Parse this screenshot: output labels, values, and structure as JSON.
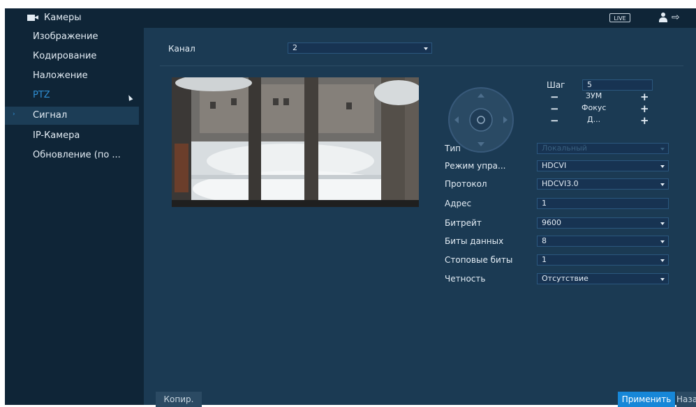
{
  "header": {
    "brand": "Камеры",
    "live_badge": "LIVE",
    "user_icon": "user-icon",
    "logout_icon": "logout-icon"
  },
  "sidebar": {
    "items": [
      {
        "label": "Изображение"
      },
      {
        "label": "Кодирование"
      },
      {
        "label": "Наложение"
      },
      {
        "label": "PTZ",
        "active": true
      },
      {
        "label": "Сигнал"
      },
      {
        "label": "IP-Камера"
      },
      {
        "label": "Обновление (по ..."
      }
    ],
    "active_color": "#2f8fd4"
  },
  "channel": {
    "label": "Канал",
    "value": "2"
  },
  "ptz_controls": {
    "step_label": "Шаг",
    "step_value": "5",
    "zoom_label": "ЗУМ",
    "focus_label": "Фокус",
    "iris_label": "Д...",
    "minus": "−",
    "plus": "+"
  },
  "settings": [
    {
      "label": "Тип",
      "value": "Локальный",
      "disabled": true,
      "type": "select"
    },
    {
      "label": "Режим упра...",
      "value": "HDCVI",
      "type": "select"
    },
    {
      "label": "Протокол",
      "value": "HDCVI3.0",
      "type": "select"
    },
    {
      "label": "Адрес",
      "value": "1",
      "type": "input"
    },
    {
      "label": "Битрейт",
      "value": "9600",
      "type": "select"
    },
    {
      "label": "Биты данных",
      "value": "8",
      "type": "select"
    },
    {
      "label": "Стоповые биты",
      "value": "1",
      "type": "select"
    },
    {
      "label": "Четность",
      "value": "Отсутствие",
      "type": "select"
    }
  ],
  "buttons": {
    "copy": "Копир.",
    "apply": "Применить",
    "back": "Назад"
  },
  "colors": {
    "panel": "#1b3a53",
    "sidebar": "#0f2537",
    "accent": "#1787d8"
  }
}
